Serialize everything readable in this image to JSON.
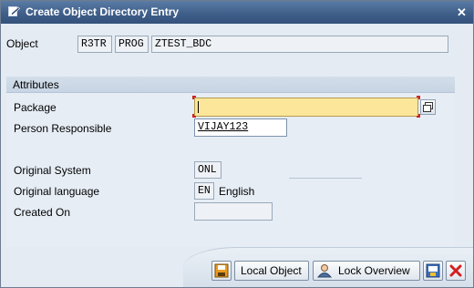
{
  "window": {
    "title": "Create Object Directory Entry",
    "close_glyph": "✕"
  },
  "object": {
    "label": "Object",
    "pgmid": "R3TR",
    "type": "PROG",
    "name": "ZTEST_BDC"
  },
  "attributes": {
    "header": "Attributes",
    "package": {
      "label": "Package",
      "value": ""
    },
    "person": {
      "label": "Person Responsible",
      "value": "VIJAY123"
    },
    "original_system": {
      "label": "Original System",
      "value": "ONL"
    },
    "original_language": {
      "label": "Original language",
      "code": "EN",
      "text": "English"
    },
    "created_on": {
      "label": "Created On",
      "value": ""
    }
  },
  "toolbar": {
    "local_object_label": "Local Object",
    "lock_overview_label": "Lock Overview"
  },
  "colors": {
    "title_bar": "#3f5f8a",
    "required_field": "#fbe69a",
    "cancel_red": "#d22020"
  },
  "icons": [
    "pencil-page-icon",
    "window-close-icon",
    "value-help-icon",
    "save-icon",
    "lock-overview-icon",
    "info-icon",
    "cancel-icon"
  ]
}
